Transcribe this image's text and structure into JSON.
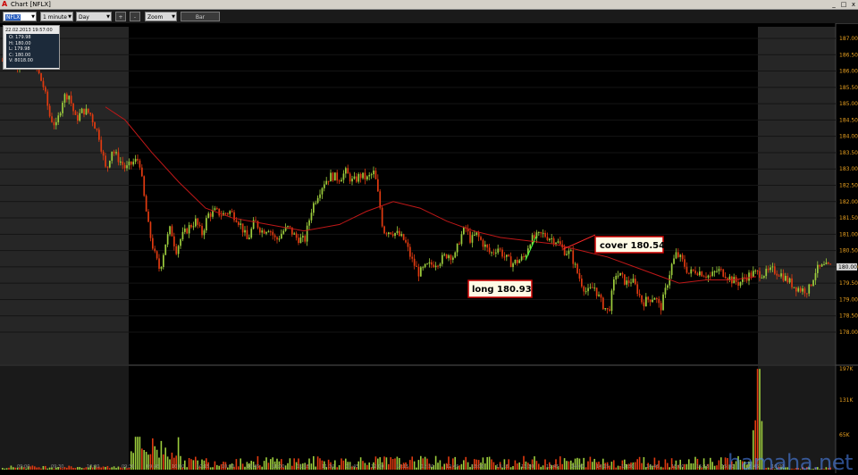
{
  "window": {
    "title": "Chart [NFLX]",
    "buttons": [
      "_",
      "□",
      "x"
    ]
  },
  "toolbar": {
    "symbol": "NFLX",
    "interval": "1 minute",
    "range": "Day",
    "plus": "+",
    "minus": "-",
    "zoom": "Zoom",
    "chart_style": "Bar"
  },
  "info": {
    "timestamp": "22.02.2013 19:57:00",
    "open": "O: 179.98",
    "high": "H: 180.00",
    "low": "L: 179.98",
    "close": "C: 180.00",
    "volume": "V: 8018.00"
  },
  "annotations": {
    "long": "long 180.93",
    "cover": "cover 180.54"
  },
  "watermark": "hamaha.net",
  "colors": {
    "up": "#9ccc3c",
    "down": "#e03a10",
    "ma": "#c01818",
    "axis_text": "#e8a020",
    "pre_post": "#2a2a2a"
  },
  "chart_data": {
    "type": "candlestick",
    "symbol": "NFLX",
    "interval": "1 minute",
    "price_ticks": [
      "187.00",
      "186.50",
      "186.00",
      "185.50",
      "185.00",
      "184.50",
      "184.00",
      "183.50",
      "183.00",
      "182.50",
      "182.00",
      "181.50",
      "181.00",
      "180.50",
      "180.00",
      "179.50",
      "179.00",
      "178.50",
      "178.00"
    ],
    "price_range": [
      177.9,
      187.2
    ],
    "last_price": "180.00",
    "volume_ticks": [
      "197K",
      "131K",
      "65K"
    ],
    "volume_range": [
      0,
      197000
    ],
    "time_ticks": [
      "09:00",
      "09:30",
      "10:00",
      "09:30",
      "09:45",
      "10:00",
      "10:15",
      "10:30",
      "10:45",
      "11:00",
      "11:15",
      "11:30",
      "11:45",
      "12:00",
      "12:15",
      "12:30",
      "12:45",
      "13:00",
      "13:15",
      "13:30",
      "13:45",
      "14:00",
      "14:15",
      "14:30",
      "14:45",
      "15:00",
      "15:15",
      "15:30",
      "15:45",
      "16:00"
    ],
    "close_path": [
      [
        0,
        186.3
      ],
      [
        10,
        186.4
      ],
      [
        20,
        186.2
      ],
      [
        30,
        186.5
      ],
      [
        40,
        186.1
      ],
      [
        48,
        185.5
      ],
      [
        55,
        184.6
      ],
      [
        62,
        184.3
      ],
      [
        70,
        185.2
      ],
      [
        76,
        185.3
      ],
      [
        84,
        184.5
      ],
      [
        92,
        184.8
      ],
      [
        100,
        184.7
      ],
      [
        110,
        184.0
      ],
      [
        118,
        182.9
      ],
      [
        124,
        183.6
      ],
      [
        132,
        183.3
      ],
      [
        140,
        183.0
      ],
      [
        148,
        183.2
      ],
      [
        155,
        183.3
      ],
      [
        160,
        182.2
      ],
      [
        166,
        181.1
      ],
      [
        172,
        180.4
      ],
      [
        178,
        179.9
      ],
      [
        184,
        180.7
      ],
      [
        190,
        181.2
      ],
      [
        196,
        180.5
      ],
      [
        202,
        180.9
      ],
      [
        210,
        181.2
      ],
      [
        218,
        181.4
      ],
      [
        225,
        181.0
      ],
      [
        232,
        181.6
      ],
      [
        240,
        181.7
      ],
      [
        248,
        181.6
      ],
      [
        256,
        181.7
      ],
      [
        264,
        181.5
      ],
      [
        270,
        181.2
      ],
      [
        276,
        180.8
      ],
      [
        284,
        181.4
      ],
      [
        292,
        181.1
      ],
      [
        300,
        181.2
      ],
      [
        308,
        180.8
      ],
      [
        316,
        181.1
      ],
      [
        322,
        181.2
      ],
      [
        330,
        180.9
      ],
      [
        340,
        180.8
      ],
      [
        348,
        181.8
      ],
      [
        356,
        182.3
      ],
      [
        362,
        182.6
      ],
      [
        370,
        182.8
      ],
      [
        378,
        182.7
      ],
      [
        386,
        182.9
      ],
      [
        394,
        182.6
      ],
      [
        402,
        182.8
      ],
      [
        410,
        182.7
      ],
      [
        418,
        182.9
      ],
      [
        424,
        181.9
      ],
      [
        428,
        181.1
      ],
      [
        436,
        181.1
      ],
      [
        444,
        181.0
      ],
      [
        452,
        180.8
      ],
      [
        460,
        180.2
      ],
      [
        468,
        179.8
      ],
      [
        476,
        180.0
      ],
      [
        484,
        180.1
      ],
      [
        492,
        180.2
      ],
      [
        500,
        180.4
      ],
      [
        508,
        180.3
      ],
      [
        514,
        180.9
      ],
      [
        520,
        181.2
      ],
      [
        526,
        180.8
      ],
      [
        532,
        181.0
      ],
      [
        540,
        180.7
      ],
      [
        548,
        180.4
      ],
      [
        556,
        180.6
      ],
      [
        564,
        180.3
      ],
      [
        572,
        180.1
      ],
      [
        580,
        180.2
      ],
      [
        586,
        180.3
      ],
      [
        592,
        180.8
      ],
      [
        598,
        180.9
      ],
      [
        606,
        181.0
      ],
      [
        614,
        180.9
      ],
      [
        622,
        180.8
      ],
      [
        630,
        180.5
      ],
      [
        638,
        180.4
      ],
      [
        644,
        179.9
      ],
      [
        650,
        179.5
      ],
      [
        656,
        179.2
      ],
      [
        664,
        179.4
      ],
      [
        672,
        178.9
      ],
      [
        680,
        178.6
      ],
      [
        688,
        179.8
      ],
      [
        694,
        179.7
      ],
      [
        700,
        179.5
      ],
      [
        706,
        179.6
      ],
      [
        712,
        179.3
      ],
      [
        718,
        178.9
      ],
      [
        724,
        179.0
      ],
      [
        732,
        179.1
      ],
      [
        738,
        178.7
      ],
      [
        744,
        179.3
      ],
      [
        750,
        180.0
      ],
      [
        756,
        180.4
      ],
      [
        762,
        180.2
      ],
      [
        770,
        179.8
      ],
      [
        778,
        179.9
      ],
      [
        786,
        179.8
      ],
      [
        794,
        179.7
      ],
      [
        802,
        179.9
      ],
      [
        810,
        179.8
      ],
      [
        818,
        179.6
      ],
      [
        826,
        179.5
      ],
      [
        834,
        179.7
      ],
      [
        842,
        179.8
      ],
      [
        848,
        179.8
      ],
      [
        856,
        179.8
      ],
      [
        864,
        179.9
      ],
      [
        872,
        179.8
      ],
      [
        880,
        179.6
      ],
      [
        888,
        179.4
      ],
      [
        896,
        179.3
      ],
      [
        904,
        179.3
      ],
      [
        912,
        179.9
      ],
      [
        920,
        180.0
      ],
      [
        928,
        180.0
      ]
    ],
    "ma_path": [
      [
        118,
        184.9
      ],
      [
        140,
        184.5
      ],
      [
        170,
        183.5
      ],
      [
        200,
        182.6
      ],
      [
        230,
        181.8
      ],
      [
        260,
        181.5
      ],
      [
        300,
        181.3
      ],
      [
        340,
        181.1
      ],
      [
        380,
        181.3
      ],
      [
        410,
        181.7
      ],
      [
        440,
        182.0
      ],
      [
        470,
        181.8
      ],
      [
        500,
        181.4
      ],
      [
        530,
        181.1
      ],
      [
        560,
        180.9
      ],
      [
        590,
        180.8
      ],
      [
        620,
        180.7
      ],
      [
        650,
        180.5
      ],
      [
        680,
        180.3
      ],
      [
        710,
        180.0
      ],
      [
        740,
        179.7
      ],
      [
        760,
        179.5
      ],
      [
        790,
        179.6
      ],
      [
        820,
        179.6
      ],
      [
        846,
        179.7
      ]
    ],
    "volume_bars_approx": "heavy at open (~60K) and close (~197K spike), light midday (~5-20K)"
  }
}
